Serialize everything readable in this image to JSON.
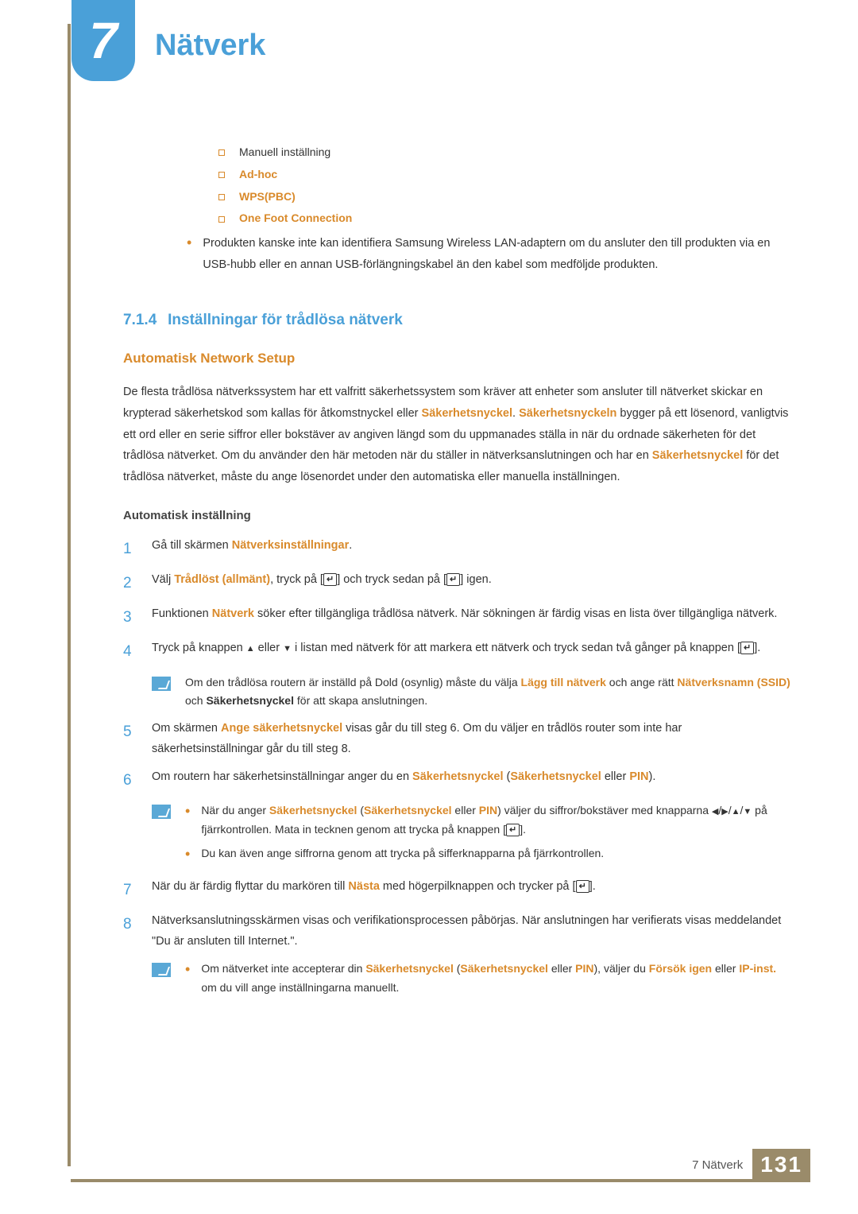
{
  "chapter": {
    "number": "7",
    "title": "Nätverk"
  },
  "top_list": {
    "items": [
      {
        "label": "Manuell inställning",
        "bold": false
      },
      {
        "label": "Ad-hoc",
        "bold": true
      },
      {
        "label": "WPS(PBC)",
        "bold": true
      },
      {
        "label": "One Foot Connection",
        "bold": true
      }
    ],
    "note": "Produkten kanske inte kan identifiera Samsung Wireless LAN-adaptern om du ansluter den till produkten via en USB-hubb eller en annan USB-förlängningskabel än den kabel som medföljde produkten."
  },
  "section": {
    "num": "7.1.4",
    "title": "Inställningar för trådlösa nätverk"
  },
  "auto_setup": {
    "heading": "Automatisk Network Setup",
    "p1a": "De flesta trådlösa nätverkssystem har ett valfritt säkerhetssystem som kräver att enheter som ansluter till nätverket skickar en krypterad säkerhetskod som kallas för åtkomstnyckel eller ",
    "p1_key1": "Säkerhetsnyckel",
    "p1b": ". ",
    "p1_key2": "Säkerhetsnyckeln",
    "p1c": " bygger på ett lösenord, vanligtvis ett ord eller en serie siffror eller bokstäver av angiven längd som du uppmanades ställa in när du ordnade säkerheten för det trådlösa nätverket. Om du använder den här metoden när du ställer in nätverksanslutningen och har en ",
    "p1_key3": "Säkerhetsnyckel",
    "p1d": " för det trådlösa nätverket, måste du ange lösenordet under den automatiska eller manuella inställningen."
  },
  "auto_inst": {
    "heading": "Automatisk inställning",
    "s1a": "Gå till skärmen ",
    "s1b": "Nätverksinställningar",
    "s1c": ".",
    "s2a": "Välj ",
    "s2b": "Trådlöst (allmänt)",
    "s2c": ", tryck på [",
    "s2d": "] och tryck sedan på [",
    "s2e": "] igen.",
    "s3a": "Funktionen ",
    "s3b": "Nätverk",
    "s3c": " söker efter tillgängliga trådlösa nätverk. När sökningen är färdig visas en lista över tillgängliga nätverk.",
    "s4a": "Tryck på knappen ",
    "s4b": " eller ",
    "s4c": " i listan med nätverk för att markera ett nätverk och tryck sedan två gånger på knappen [",
    "s4d": "].",
    "note4a": "Om den trådlösa routern är inställd på Dold (osynlig) måste du välja ",
    "note4b": "Lägg till nätverk",
    "note4c": " och ange rätt ",
    "note4d": "Nätverksnamn (SSID)",
    "note4e": " och ",
    "note4f": "Säkerhetsnyckel",
    "note4g": " för att skapa anslutningen.",
    "s5a": "Om skärmen ",
    "s5b": "Ange säkerhetsnyckel",
    "s5c": " visas går du till steg 6. Om du väljer en trådlös router som inte har säkerhetsinställningar går du till steg 8.",
    "s6a": "Om routern har säkerhetsinställningar anger du en ",
    "s6b": "Säkerhetsnyckel",
    "s6c": " (",
    "s6d": "Säkerhetsnyckel",
    "s6e": " eller ",
    "s6f": "PIN",
    "s6g": ").",
    "note6_1a": "När du anger ",
    "note6_1b": "Säkerhetsnyckel",
    "note6_1c": " (",
    "note6_1d": "Säkerhetsnyckel",
    "note6_1e": " eller ",
    "note6_1f": "PIN",
    "note6_1g": ") väljer du siffror/bokstäver med knapparna ",
    "note6_1h": " på fjärrkontrollen. Mata in tecknen genom att trycka på knappen [",
    "note6_1i": "].",
    "note6_2": "Du kan även ange siffrorna genom att trycka på sifferknapparna på fjärrkontrollen.",
    "s7a": "När du är färdig flyttar du markören till ",
    "s7b": "Nästa",
    "s7c": " med högerpilknappen och trycker på [",
    "s7d": "].",
    "s8": "Nätverksanslutningsskärmen visas och verifikationsprocessen påbörjas. När anslutningen har verifierats visas meddelandet \"Du är ansluten till Internet.\".",
    "note8a": "Om nätverket inte accepterar din ",
    "note8b": "Säkerhetsnyckel",
    "note8c": " (",
    "note8d": "Säkerhetsnyckel",
    "note8e": " eller ",
    "note8f": "PIN",
    "note8g": "), väljer du ",
    "note8h": "Försök igen",
    "note8i": " eller ",
    "note8j": "IP-inst.",
    "note8k": " om du vill ange inställningarna manuellt."
  },
  "footer": {
    "label": "7 Nätverk",
    "page": "131"
  },
  "enter_glyph": "↵"
}
